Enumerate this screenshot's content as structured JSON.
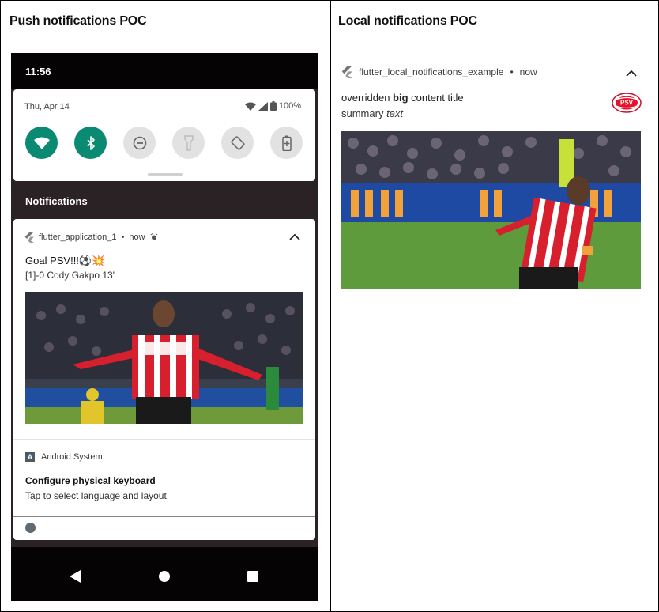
{
  "table": {
    "left_header": "Push notifications POC",
    "right_header": "Local notifications POC"
  },
  "phone": {
    "status_time": "11:56",
    "quick_settings": {
      "date": "Thu, Apr 14",
      "battery": "100%",
      "tiles": [
        {
          "name": "wifi",
          "state": "on"
        },
        {
          "name": "bluetooth",
          "state": "on"
        },
        {
          "name": "do-not-disturb",
          "state": "off"
        },
        {
          "name": "flashlight",
          "state": "off"
        },
        {
          "name": "auto-rotate",
          "state": "off"
        },
        {
          "name": "battery-saver",
          "state": "off"
        }
      ]
    },
    "notifications_header": "Notifications",
    "push_notification": {
      "app_name": "flutter_application_1",
      "time": "now",
      "title": "Goal PSV!!!⚽💥",
      "body": "[1]-0 Cody Gakpo 13'"
    },
    "system_notification": {
      "app_name": "Android System",
      "title": "Configure physical keyboard",
      "body": "Tap to select language and layout"
    }
  },
  "local_notification": {
    "app_name": "flutter_local_notifications_example",
    "time": "now",
    "title_prefix": "overridden ",
    "title_bold": "big",
    "title_suffix": " content title",
    "summary_prefix": "summary ",
    "summary_italic": "text",
    "logo_text": "PSV"
  },
  "colors": {
    "tile_on": "#0b8a73",
    "tile_off": "#e2e2e2",
    "psv_red": "#e3132b"
  }
}
